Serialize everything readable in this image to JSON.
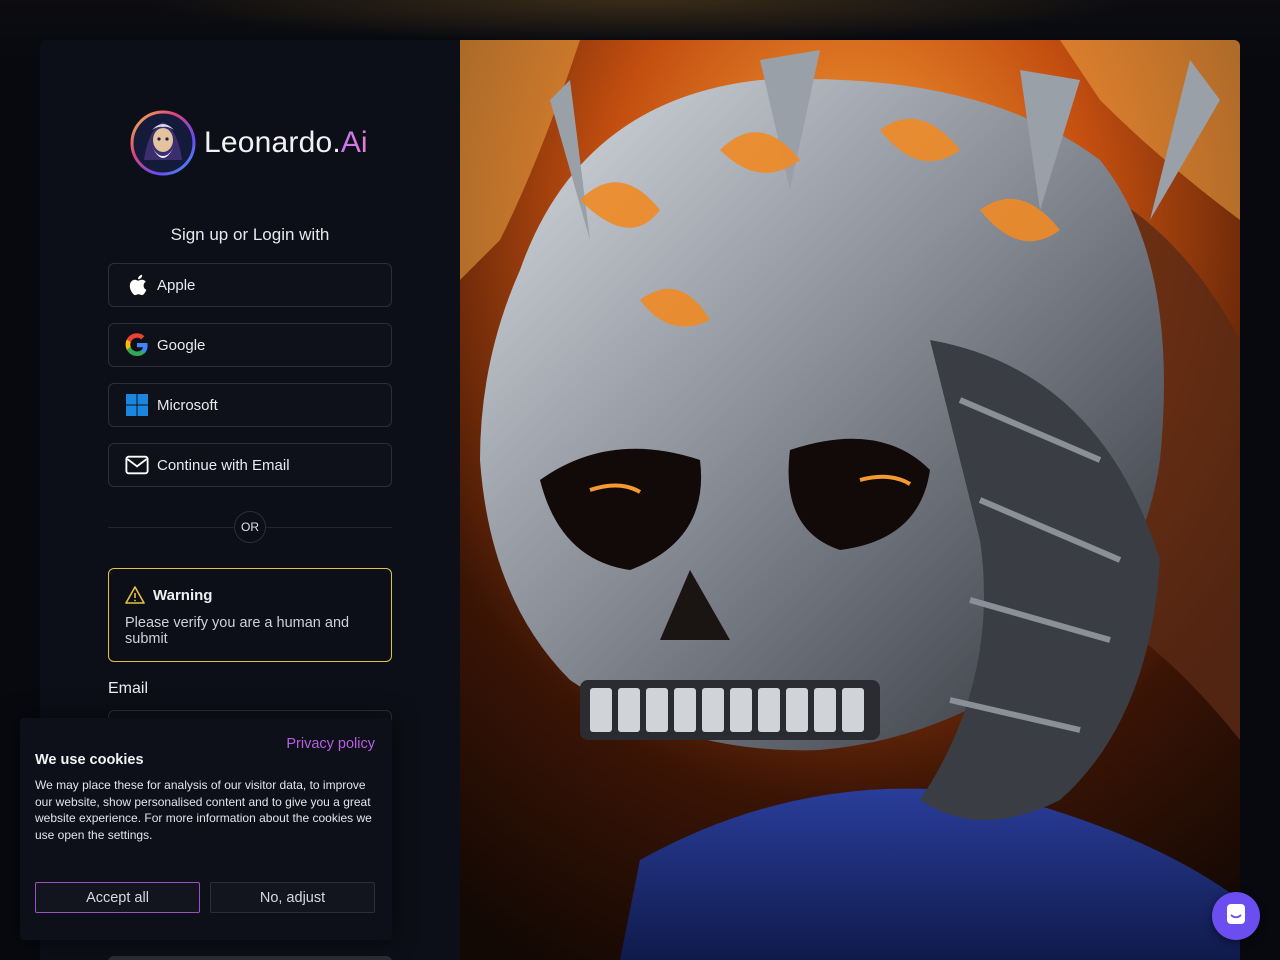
{
  "brand": {
    "name": "Leonardo.",
    "suffix": "Ai"
  },
  "login": {
    "heading": "Sign up or Login with",
    "providers": [
      {
        "label": "Apple",
        "icon": "apple-icon"
      },
      {
        "label": "Google",
        "icon": "google-icon"
      },
      {
        "label": "Microsoft",
        "icon": "microsoft-icon"
      },
      {
        "label": "Continue with Email",
        "icon": "mail-icon"
      }
    ],
    "divider": "OR",
    "warning": {
      "title": "Warning",
      "text": "Please verify you are a human and submit",
      "icon": "warning-icon",
      "color": "#e6c040"
    },
    "email_label": "Email",
    "email_value": ""
  },
  "cookies": {
    "privacy_link": "Privacy policy",
    "title": "We use cookies",
    "text": "We may place these for analysis of our visitor data, to improve our website, show personalised content and to give you a great website experience. For more information about the cookies we use open the settings.",
    "accept_label": "Accept all",
    "adjust_label": "No, adjust"
  },
  "chat": {
    "icon": "chat-icon",
    "color": "#6c4ef0"
  },
  "colors": {
    "accent": "#b95de3",
    "background": "#0c0f17"
  }
}
